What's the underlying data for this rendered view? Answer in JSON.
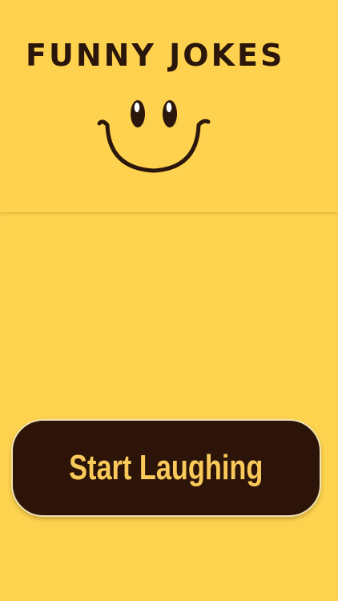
{
  "app": {
    "title": "FUNNY JOKES"
  },
  "start_button": {
    "label": "Start Laughing"
  },
  "icons": {
    "logo": "smiley-face-icon"
  },
  "colors": {
    "background": "#fdd24f",
    "header_panel": "#fed24f",
    "ink": "#2b160b",
    "button_fill": "#2c1409",
    "button_text": "#f9c95a",
    "eye_highlight": "#ffffff"
  }
}
